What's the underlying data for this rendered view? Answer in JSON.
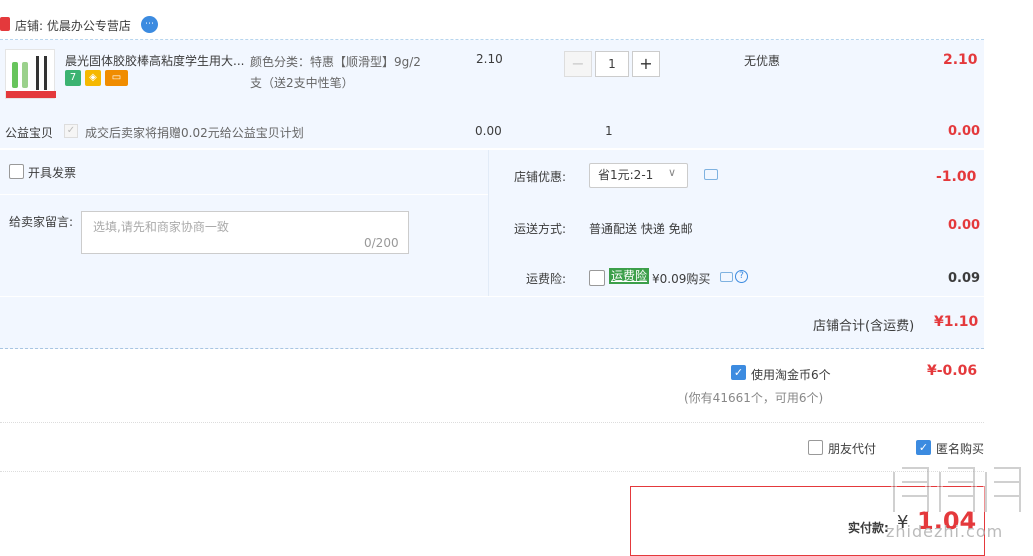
{
  "shop": {
    "label": "店铺: 优晨办公专营店",
    "ww_icon": "chat-bubble-icon"
  },
  "item": {
    "title": "晨光固体胶胶棒高粘度学生用大...",
    "tags": [
      {
        "name": "seven-day-return-icon",
        "text": "7",
        "color": "#3cb371"
      },
      {
        "name": "guarantee-icon",
        "text": "◈",
        "color": "#f5b800"
      },
      {
        "name": "card-icon",
        "text": "▭",
        "color": "#f08c00"
      }
    ],
    "sku": "颜色分类：特惠【顺滑型】9g/2支（送2支中性笔）",
    "unit_price": "2.10",
    "qty_minus": "−",
    "qty_value": "1",
    "qty_plus": "+",
    "promo": "无优惠",
    "subtotal": "2.10"
  },
  "charity": {
    "label": "公益宝贝",
    "desc": "成交后卖家将捐赠0.02元给公益宝贝计划",
    "price": "0.00",
    "qty": "1",
    "subtotal": "0.00"
  },
  "invoice": {
    "label": "开具发票"
  },
  "message": {
    "label": "给卖家留言:",
    "placeholder": "选填,请先和商家协商一致",
    "count": "0/200"
  },
  "coupon": {
    "label": "店铺优惠:",
    "selected": "省1元:2-1",
    "value": "-1.00"
  },
  "shipping": {
    "label": "运送方式:",
    "method": "普通配送 快递 免邮",
    "value": "0.00"
  },
  "insurance": {
    "label": "运费险:",
    "badge": "运费险",
    "price": "¥0.09购买",
    "value": "0.09"
  },
  "shop_total": {
    "label": "店铺合计(含运费)",
    "value": "¥1.10"
  },
  "coins": {
    "label": "使用淘金币6个",
    "value": "¥-0.06",
    "note": "(你有41661个，可用6个)"
  },
  "options": {
    "friend_pay": "朋友代付",
    "anonymous": "匿名购买"
  },
  "payment": {
    "label": "实付款:",
    "currency": "¥",
    "amount": "1.04"
  },
  "watermark": {
    "url": "zhidezhi.com"
  },
  "colors": {
    "accent_red": "#e4393c",
    "accent_blue": "#3c8be0",
    "row_bg": "#f2f7ff",
    "green_badge": "#3c9f4a"
  }
}
